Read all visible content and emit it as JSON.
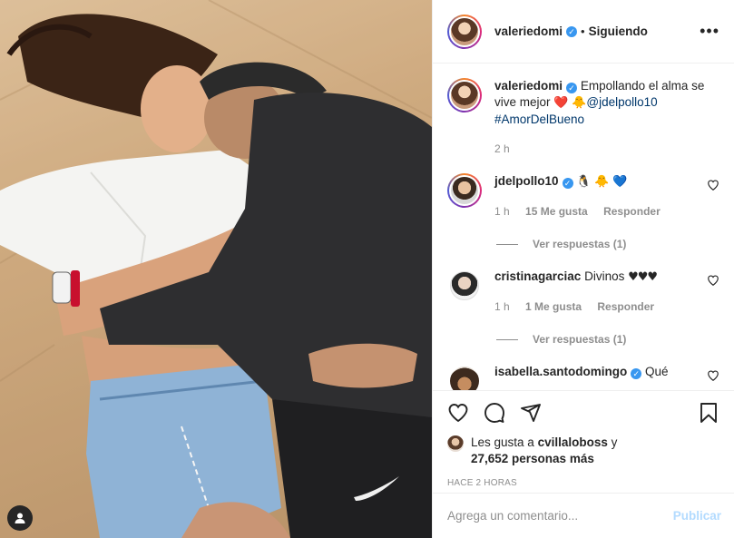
{
  "post": {
    "author": "valeriedomi",
    "follow_state": "Siguiendo",
    "dot": "•"
  },
  "caption": {
    "user": "valeriedomi",
    "text_part1": "Empollando el alma se vive mejor",
    "emoji_heart": "❤️",
    "emoji_chick": "🐥",
    "mention": "@jdelpollo10",
    "hashtag": "#AmorDelBueno",
    "time": "2 h"
  },
  "comments": [
    {
      "user": "jdelpollo10",
      "verified": true,
      "text": "",
      "emojis": [
        "🐧",
        "🐥",
        "💙"
      ],
      "time": "1 h",
      "likes": "15 Me gusta",
      "reply_label": "Responder",
      "view_replies": "Ver respuestas (1)"
    },
    {
      "user": "cristinagarciac",
      "verified": false,
      "text": "Divinos",
      "emojis": [
        "♥♥♥"
      ],
      "time": "1 h",
      "likes": "1 Me gusta",
      "reply_label": "Responder",
      "view_replies": "Ver respuestas (1)"
    },
    {
      "user": "isabella.santodomingo",
      "verified": true,
      "text": "Qué",
      "emojis": []
    }
  ],
  "likes": {
    "prefix": "Les gusta a",
    "user": "cvillaloboss",
    "connector": "y",
    "others": "27,652 personas más"
  },
  "timestamp": "HACE 2 HORAS",
  "add_comment": {
    "placeholder": "Agrega un comentario...",
    "post_label": "Publicar"
  },
  "icons": {
    "more": "more-options-icon",
    "like": "heart-icon",
    "comment": "comment-icon",
    "share": "share-icon",
    "save": "bookmark-icon",
    "tag": "user-tag-icon"
  },
  "colors": {
    "link": "#00376b",
    "verified": "#3897f0",
    "muted": "#8e8e8e",
    "publish_disabled": "#b3dbff"
  }
}
